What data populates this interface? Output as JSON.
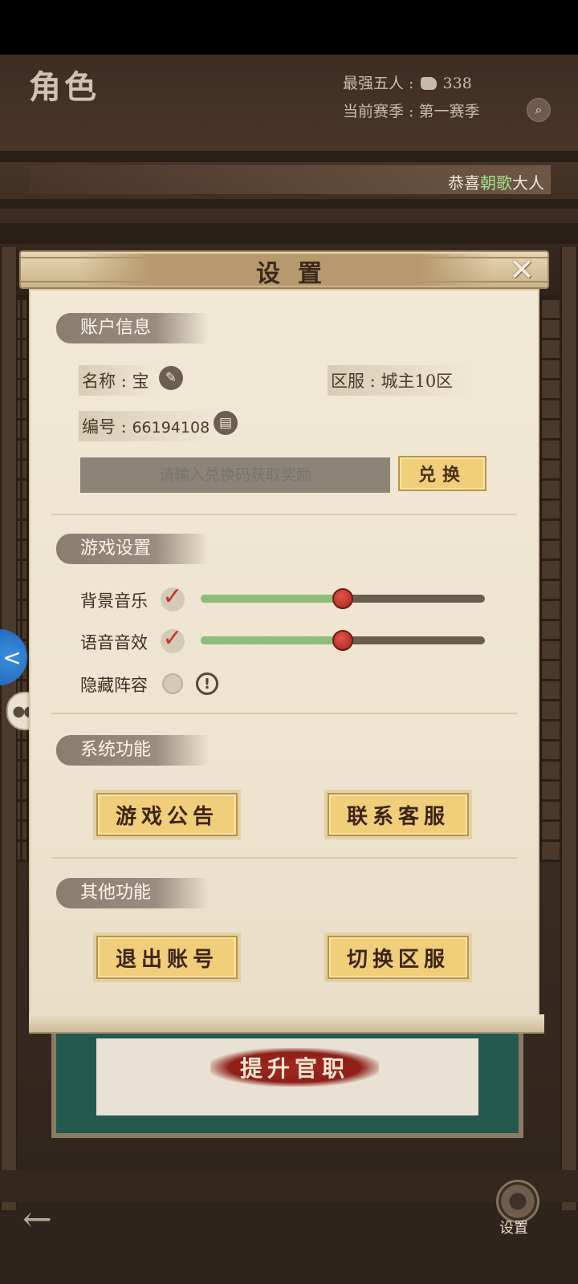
{
  "hud": {
    "page_title": "角色",
    "strongest_label": "最强五人 :",
    "strongest_value": "338",
    "season_label": "当前赛季 :",
    "season_value": "第一赛季",
    "banner_prefix": "恭喜",
    "banner_name": "朝歌",
    "banner_suffix": "大人"
  },
  "settings": {
    "title": "设置",
    "account": {
      "section_label": "账户信息",
      "name_label": "名称 :",
      "name_value": "宝",
      "server_label": "区服 :",
      "server_value": "城主10区",
      "id_label": "编号 :",
      "id_value": "66194108",
      "redeem_placeholder": "请输入兑换码获取奖励",
      "redeem_button": "兑换"
    },
    "game": {
      "section_label": "游戏设置",
      "bgm_label": "背景音乐",
      "bgm_enabled": true,
      "bgm_level": 0.5,
      "sfx_label": "语音音效",
      "sfx_enabled": true,
      "sfx_level": 0.5,
      "hide_lineup_label": "隐藏阵容",
      "hide_lineup_enabled": false
    },
    "system": {
      "section_label": "系统功能",
      "announcement_button": "游戏公告",
      "support_button": "联系客服"
    },
    "other": {
      "section_label": "其他功能",
      "logout_button": "退出账号",
      "switch_server_button": "切换区服"
    }
  },
  "bottom": {
    "promote_label": "提升官职",
    "settings_label": "设置"
  },
  "colors": {
    "accent_gold": "#f1cf7a",
    "slider_fill": "#8fbe7b",
    "slider_knob": "#c0352c",
    "check_red": "#c8342d",
    "highlight_green": "#a6e08e"
  }
}
